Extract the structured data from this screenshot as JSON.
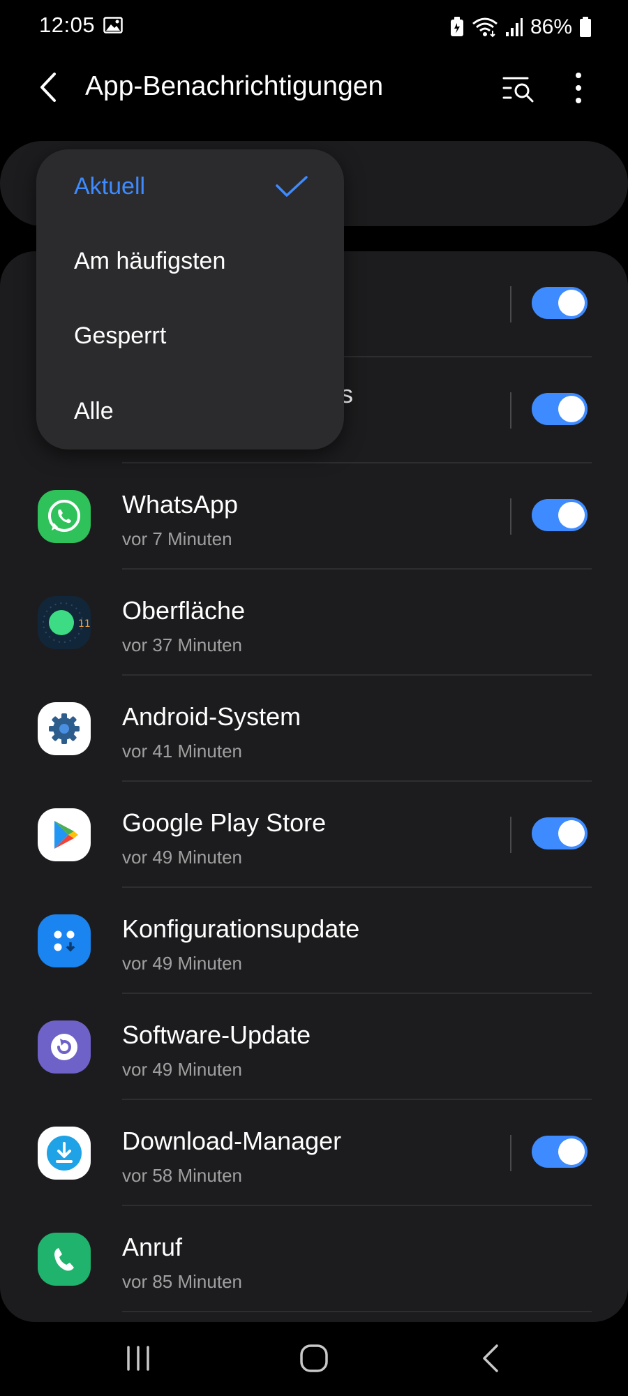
{
  "status_bar": {
    "time": "12:05",
    "battery": "86%",
    "icons": [
      "gallery-icon",
      "battery-saver-icon",
      "wifi-icon",
      "signal-icon",
      "battery-icon"
    ]
  },
  "header": {
    "title": "App-Benachrichtigungen",
    "icons": [
      "back-icon",
      "filter-search-icon",
      "more-icon"
    ]
  },
  "sort_menu": {
    "items": [
      {
        "label": "Aktuell",
        "selected": true
      },
      {
        "label": "Am häufigsten",
        "selected": false
      },
      {
        "label": "Gesperrt",
        "selected": false
      },
      {
        "label": "Alle",
        "selected": false
      }
    ]
  },
  "apps": [
    {
      "name": "",
      "time": "",
      "toggle": true,
      "icon": "hidden-app-icon"
    },
    {
      "name": "s",
      "time": "",
      "toggle": true,
      "icon": "hidden-app-icon"
    },
    {
      "name": "WhatsApp",
      "time": "vor 7 Minuten",
      "toggle": true,
      "icon": "whatsapp-icon"
    },
    {
      "name": "Oberfläche",
      "time": "vor 37 Minuten",
      "toggle": false,
      "icon": "one-ui-icon"
    },
    {
      "name": "Android-System",
      "time": "vor 41 Minuten",
      "toggle": false,
      "icon": "android-system-icon"
    },
    {
      "name": "Google Play Store",
      "time": "vor 49 Minuten",
      "toggle": true,
      "icon": "play-store-icon"
    },
    {
      "name": "Konfigurationsupdate",
      "time": "vor 49 Minuten",
      "toggle": false,
      "icon": "config-update-icon"
    },
    {
      "name": "Software-Update",
      "time": "vor 49 Minuten",
      "toggle": false,
      "icon": "software-update-icon"
    },
    {
      "name": "Download-Manager",
      "time": "vor 58 Minuten",
      "toggle": true,
      "icon": "download-manager-icon"
    },
    {
      "name": "Anruf",
      "time": "vor 85 Minuten",
      "toggle": false,
      "icon": "phone-icon"
    }
  ],
  "colors": {
    "accent": "#3e8bff",
    "background": "#000000",
    "card": "#1c1c1e",
    "menu": "#2b2b2d",
    "secondary_text": "#a0a0a0"
  },
  "nav_bar": {
    "icons": [
      "recents-icon",
      "home-icon",
      "nav-back-icon"
    ]
  }
}
